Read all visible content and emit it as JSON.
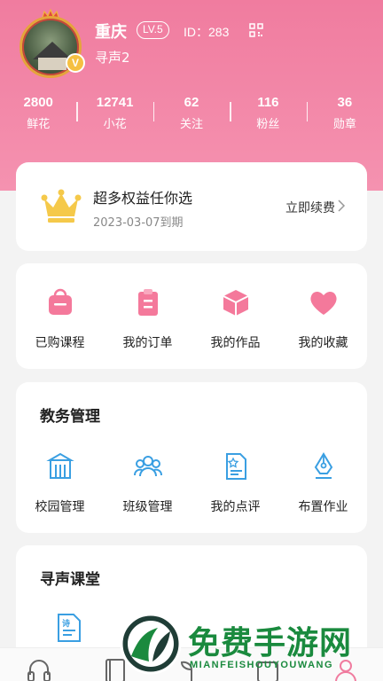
{
  "profile": {
    "name": "重庆",
    "level": "LV.5",
    "id_text": "ID：283",
    "subtitle": "寻声2",
    "badge": "V"
  },
  "stats": [
    {
      "value": "2800",
      "label": "鲜花"
    },
    {
      "value": "12741",
      "label": "小花"
    },
    {
      "value": "62",
      "label": "关注"
    },
    {
      "value": "116",
      "label": "粉丝"
    },
    {
      "value": "36",
      "label": "勋章"
    }
  ],
  "vip": {
    "title": "超多权益任你选",
    "expiry": "2023-03-07到期",
    "renew_label": "立即续费"
  },
  "quick_links": [
    {
      "label": "已购课程",
      "icon": "bag-icon"
    },
    {
      "label": "我的订单",
      "icon": "clipboard-icon"
    },
    {
      "label": "我的作品",
      "icon": "box-icon"
    },
    {
      "label": "我的收藏",
      "icon": "heart-icon"
    }
  ],
  "edu": {
    "title": "教务管理",
    "items": [
      {
        "label": "校园管理",
        "icon": "building-icon"
      },
      {
        "label": "班级管理",
        "icon": "group-icon"
      },
      {
        "label": "我的点评",
        "icon": "review-icon"
      },
      {
        "label": "布置作业",
        "icon": "pen-nib-icon"
      }
    ]
  },
  "classroom": {
    "title": "寻声课堂",
    "items": [
      {
        "label": "诗",
        "icon": "poem-doc-icon"
      }
    ]
  },
  "tabbar": [
    "headphones-icon",
    "book-icon",
    "sprout-icon",
    "card-icon",
    "profile-icon"
  ],
  "watermark": {
    "title": "免费手游网",
    "subtitle": "MIANFEISHOUYOUWANG"
  },
  "colors": {
    "header_pink": "#f07c9f",
    "quick_icon_pink": "#f4799b",
    "edu_icon_blue": "#3a9fe2",
    "crown_gold": "#f5c94a",
    "watermark_green": "#1a8a3e"
  }
}
